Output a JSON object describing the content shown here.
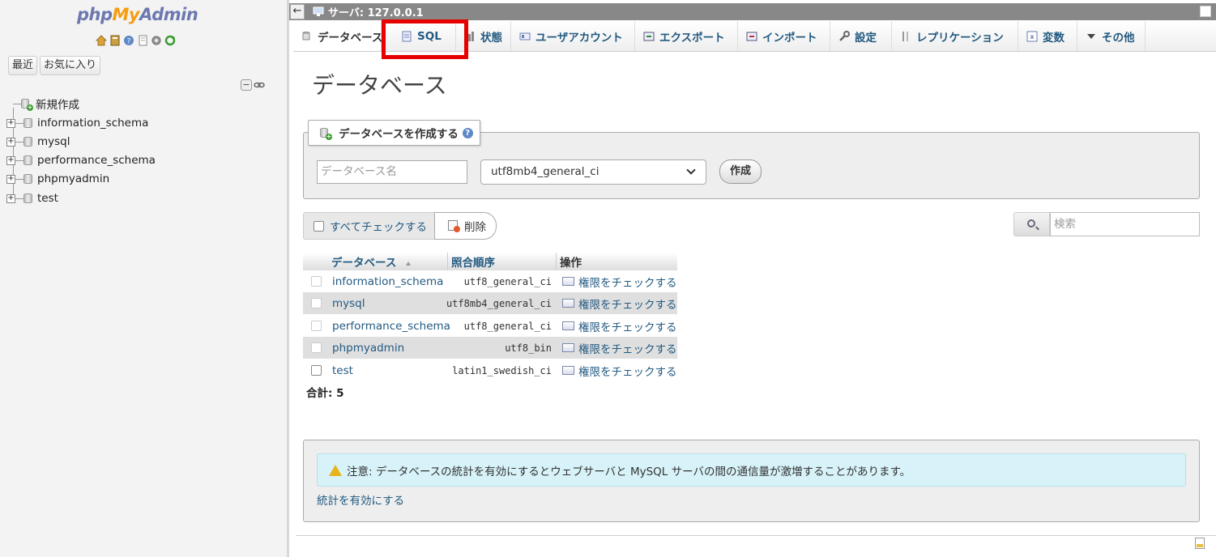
{
  "sidebar": {
    "logo": {
      "part1": "php",
      "part2": "My",
      "part3": "Admin"
    },
    "quick_icons": [
      "home-icon",
      "database-icon",
      "help-icon",
      "docs-icon",
      "settings-icon",
      "reload-icon"
    ],
    "recent_label": "最近",
    "favorites_label": "お気に入り",
    "new_label": "新規作成",
    "databases": [
      "information_schema",
      "mysql",
      "performance_schema",
      "phpmyadmin",
      "test"
    ]
  },
  "topbar": {
    "server_label": "サーバ: 127.0.0.1"
  },
  "tabs": [
    {
      "label": "データベース",
      "icon": "database-icon"
    },
    {
      "label": "SQL",
      "icon": "sql-icon"
    },
    {
      "label": "状態",
      "icon": "status-icon"
    },
    {
      "label": "ユーザアカウント",
      "icon": "users-icon"
    },
    {
      "label": "エクスポート",
      "icon": "export-icon"
    },
    {
      "label": "インポート",
      "icon": "import-icon"
    },
    {
      "label": "設定",
      "icon": "wrench-icon"
    },
    {
      "label": "レプリケーション",
      "icon": "replication-icon"
    },
    {
      "label": "変数",
      "icon": "variables-icon"
    },
    {
      "label": "その他",
      "icon": "triangle-down-icon"
    }
  ],
  "main": {
    "title": "データベース",
    "create": {
      "legend": "データベースを作成する",
      "name_placeholder": "データベース名",
      "collation": "utf8mb4_general_ci",
      "button": "作成"
    },
    "check_all": "すべてチェックする",
    "delete": "削除",
    "search_placeholder": "検索",
    "table": {
      "headers": {
        "database": "データベース",
        "collation": "照合順序",
        "operations": "操作"
      },
      "rows": [
        {
          "name": "information_schema",
          "collation": "utf8_general_ci",
          "action": "権限をチェックする"
        },
        {
          "name": "mysql",
          "collation": "utf8mb4_general_ci",
          "action": "権限をチェックする"
        },
        {
          "name": "performance_schema",
          "collation": "utf8_general_ci",
          "action": "権限をチェックする"
        },
        {
          "name": "phpmyadmin",
          "collation": "utf8_bin",
          "action": "権限をチェックする"
        },
        {
          "name": "test",
          "collation": "latin1_swedish_ci",
          "action": "権限をチェックする"
        }
      ],
      "total": "合計: 5"
    },
    "notice": {
      "text": "注意: データベースの統計を有効にするとウェブサーバと MySQL サーバの間の通信量が激増することがあります。",
      "link": "統計を有効にする"
    }
  },
  "colors": {
    "highlight": "#e60000",
    "link": "#235a81",
    "logo_blue": "#6c78af",
    "logo_orange": "#f89c0e",
    "notice_bg": "#d7f2f8"
  }
}
